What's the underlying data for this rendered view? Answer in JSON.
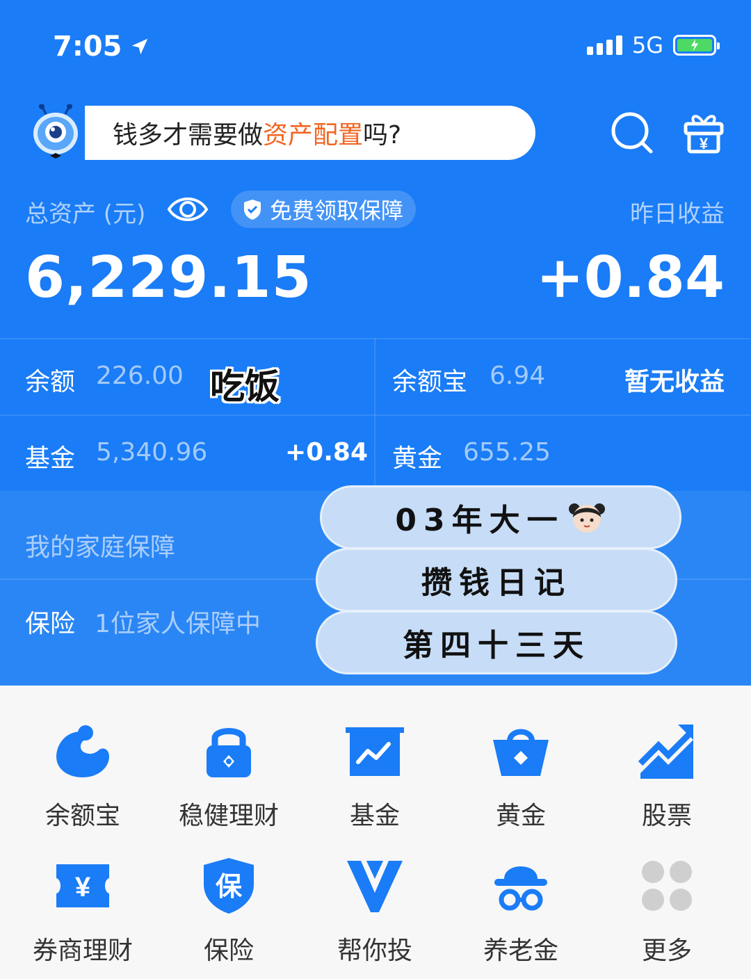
{
  "status_bar": {
    "time": "7:05",
    "network": "5G"
  },
  "header": {
    "promo_prefix": "钱多才需要做",
    "promo_highlight": "资产配置",
    "promo_suffix": "吗?"
  },
  "assets": {
    "total_label": "总资产 (元)",
    "protection_pill": "免费领取保障",
    "yesterday_label": "昨日收益",
    "total_value": "6,229.15",
    "yesterday_value": "+0.84"
  },
  "rows": {
    "balance_label": "余额",
    "balance_value": "226.00",
    "yuebao_label": "余额宝",
    "yuebao_value": "6.94",
    "yuebao_status": "暂无收益",
    "fund_label": "基金",
    "fund_value": "5,340.96",
    "fund_change": "+0.84",
    "gold_label": "黄金",
    "gold_value": "655.25",
    "family_label": "我的家庭保障",
    "insurance_label": "保险",
    "insurance_value": "1位家人保障中"
  },
  "stickers": {
    "eat": "吃饭",
    "line1": "03年大一",
    "line2": "攒钱日记",
    "line3": "第四十三天"
  },
  "menu": [
    {
      "label": "余额宝",
      "icon": "yuebao-icon"
    },
    {
      "label": "稳健理财",
      "icon": "lock-icon"
    },
    {
      "label": "基金",
      "icon": "fund-chart-icon"
    },
    {
      "label": "黄金",
      "icon": "gold-basket-icon"
    },
    {
      "label": "股票",
      "icon": "stock-arrow-icon"
    },
    {
      "label": "券商理财",
      "icon": "voucher-yen-icon"
    },
    {
      "label": "保险",
      "icon": "insurance-shield-icon"
    },
    {
      "label": "帮你投",
      "icon": "help-invest-icon"
    },
    {
      "label": "养老金",
      "icon": "pension-hat-icon"
    },
    {
      "label": "更多",
      "icon": "more-grid-icon"
    }
  ],
  "colors": {
    "primary": "#1a7cf6",
    "highlight": "#f26522",
    "icon_blue": "#1a7cf6"
  }
}
